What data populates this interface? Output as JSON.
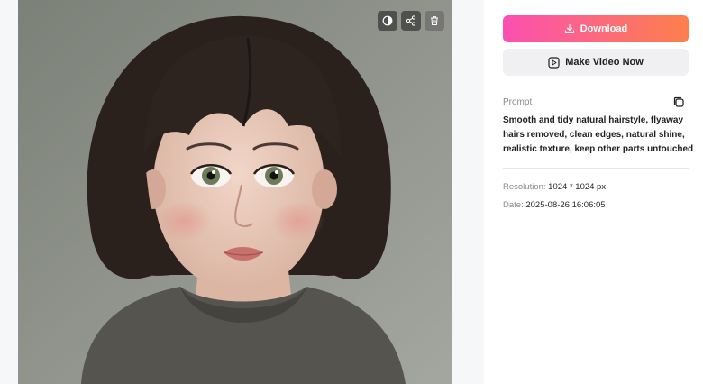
{
  "toolbar": {
    "icons": [
      "contrast-icon",
      "share-icon",
      "trash-icon"
    ]
  },
  "panel": {
    "download_label": "Download",
    "make_video_label": "Make Video Now",
    "prompt_label": "Prompt",
    "prompt_text": "Smooth and tidy natural hairstyle, flyaway hairs removed, clean edges, natural shine, realistic texture, keep other parts untouched",
    "resolution_label": "Resolution:",
    "resolution_value": "1024 * 1024 px",
    "date_label": "Date:",
    "date_value": "2025-08-26 16:06:05"
  },
  "colors": {
    "download_gradient_start": "#fb4fb3",
    "download_gradient_end": "#fd7f4c",
    "secondary_button_bg": "#f0f0f2",
    "muted_text": "#8a8a8e"
  }
}
